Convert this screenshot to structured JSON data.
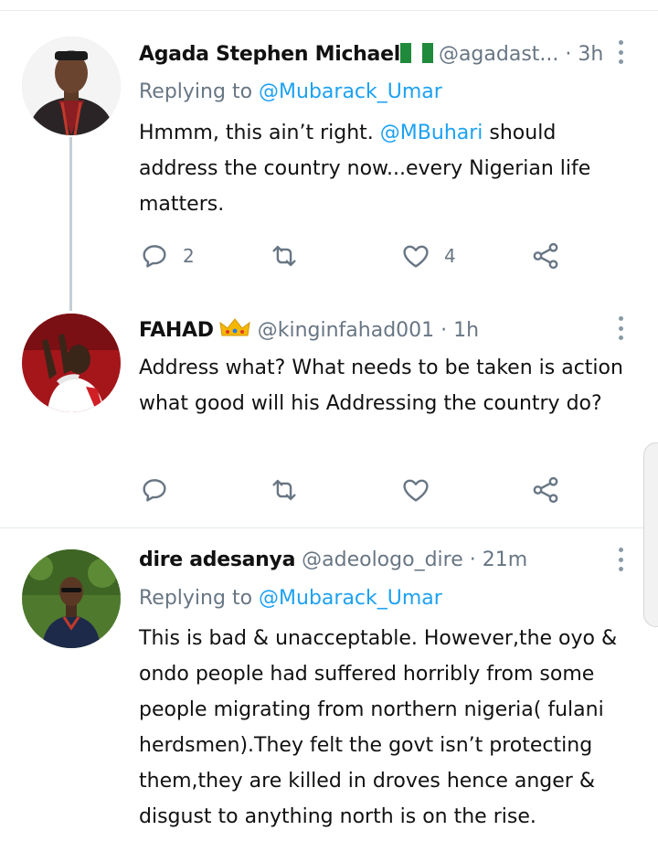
{
  "tweets": [
    {
      "name": "Agada Stephen Michael",
      "handle": "@agadast...",
      "time": "3h",
      "replying_prefix": "Replying to",
      "replying_to": "@Mubarack_Umar",
      "body_before": "Hmmm, this ain’t right.",
      "body_mention": "@MBuhari",
      "body_after": "should address the country now...every Nigerian life matters.",
      "reply_count": "2",
      "retweet_count": "",
      "like_count": "4"
    },
    {
      "name": "FAHAD",
      "handle": "@kinginfahad001",
      "time": "1h",
      "body": "Address what? What needs to be taken is action what good will his Addressing the country do?",
      "reply_count": "",
      "retweet_count": "",
      "like_count": ""
    },
    {
      "name": "dire adesanya",
      "handle": "@adeologo_dire",
      "time": "21m",
      "replying_prefix": "Replying to",
      "replying_to": "@Mubarack_Umar",
      "body": "This is bad & unacceptable. However,the oyo & ondo people had suffered horribly from some people migrating from northern nigeria( fulani herdsmen).They felt the govt isn’t protecting them,they are killed in droves hence anger & disgust to anything north is on the rise."
    }
  ],
  "separator": "·",
  "colors": {
    "link": "#1da1f2",
    "muted": "#687684",
    "text": "#111111"
  },
  "icons": [
    "reply-icon",
    "retweet-icon",
    "like-icon",
    "share-icon",
    "more-icon",
    "nigeria-flag-icon",
    "crown-icon"
  ]
}
